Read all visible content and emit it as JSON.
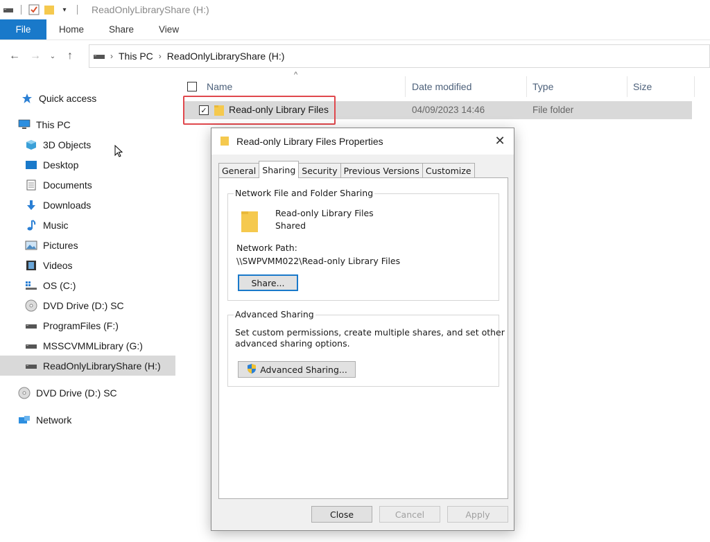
{
  "window": {
    "title": "ReadOnlyLibraryShare (H:)"
  },
  "ribbon": {
    "tabs": [
      "File",
      "Home",
      "Share",
      "View"
    ]
  },
  "address": {
    "crumbs": [
      "This PC",
      "ReadOnlyLibraryShare (H:)"
    ]
  },
  "sidebar": {
    "items": [
      {
        "label": "Quick access",
        "icon": "star-icon"
      },
      {
        "label": "This PC",
        "icon": "computer-icon"
      },
      {
        "label": "3D Objects",
        "icon": "cube-icon"
      },
      {
        "label": "Desktop",
        "icon": "desktop-icon"
      },
      {
        "label": "Documents",
        "icon": "document-icon"
      },
      {
        "label": "Downloads",
        "icon": "download-arrow-icon"
      },
      {
        "label": "Music",
        "icon": "music-note-icon"
      },
      {
        "label": "Pictures",
        "icon": "picture-icon"
      },
      {
        "label": "Videos",
        "icon": "film-icon"
      },
      {
        "label": "OS (C:)",
        "icon": "windows-drive-icon"
      },
      {
        "label": "DVD Drive (D:) SC",
        "icon": "disc-icon"
      },
      {
        "label": "ProgramFiles (F:)",
        "icon": "drive-icon"
      },
      {
        "label": "MSSCVMMLibrary (G:)",
        "icon": "drive-icon"
      },
      {
        "label": "ReadOnlyLibraryShare (H:)",
        "icon": "drive-icon"
      },
      {
        "label": "DVD Drive (D:) SC",
        "icon": "disc-icon"
      },
      {
        "label": "Network",
        "icon": "network-icon"
      }
    ]
  },
  "filelist": {
    "columns": [
      "Name",
      "Date modified",
      "Type",
      "Size"
    ],
    "rows": [
      {
        "name": "Read-only Library Files",
        "date": "04/09/2023 14:46",
        "type": "File folder",
        "size": ""
      }
    ]
  },
  "dialog": {
    "title": "Read-only Library Files Properties",
    "tabs": [
      "General",
      "Sharing",
      "Security",
      "Previous Versions",
      "Customize"
    ],
    "network_group": "Network File and Folder Sharing",
    "folder_name": "Read-only Library Files",
    "share_status": "Shared",
    "network_path_label": "Network Path:",
    "network_path": "\\\\SWPVMM022\\Read-only Library Files",
    "share_button": "Share...",
    "advanced_group": "Advanced Sharing",
    "advanced_desc_1": "Set custom permissions, create multiple shares, and set other",
    "advanced_desc_2": "advanced sharing options.",
    "advanced_button": "Advanced Sharing...",
    "close_button": "Close",
    "cancel_button": "Cancel",
    "apply_button": "Apply"
  },
  "colors": {
    "accent": "#1979ca",
    "selection": "#d9d9d9",
    "highlight": "#e0474c",
    "folder": "#f5c94e"
  }
}
